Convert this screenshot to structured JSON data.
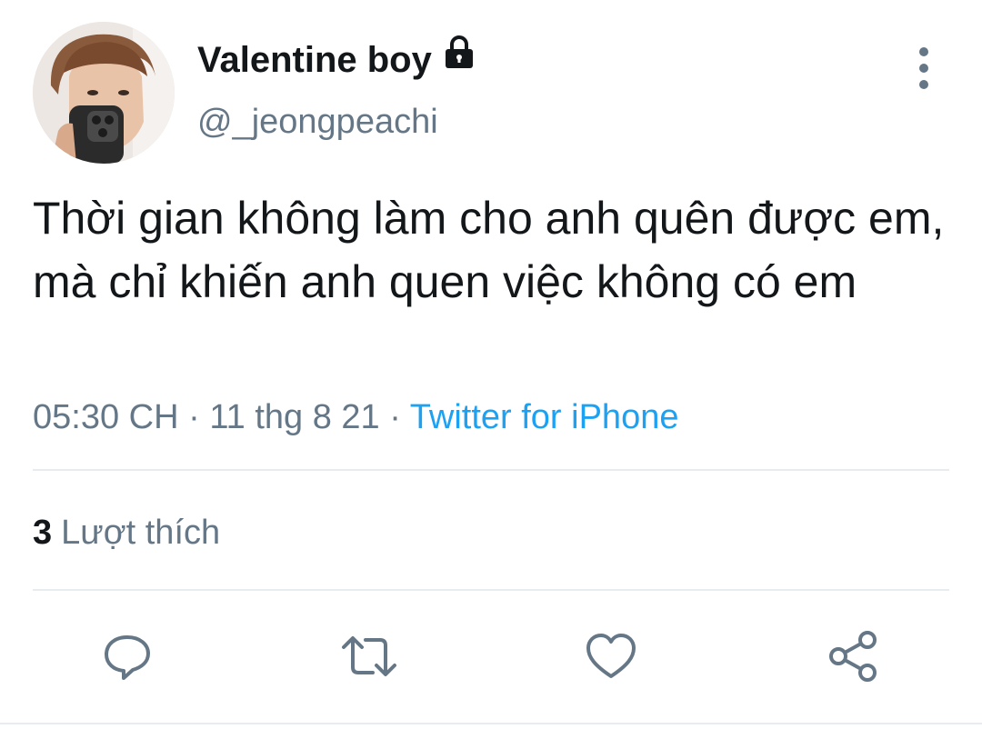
{
  "user": {
    "display_name": "Valentine boy",
    "handle": "@_jeongpeachi",
    "avatar_icon": "profile-photo",
    "protected_icon": "lock-icon"
  },
  "tweet": {
    "text": "Thời gian không làm cho anh quên được em, mà chỉ khiến anh quen việc không có em",
    "time": "05:30 CH",
    "separator1": " · ",
    "date": "11 thg 8 21",
    "separator2": " · ",
    "source": "Twitter for iPhone"
  },
  "stats": {
    "likes_count": "3",
    "likes_label": "Lượt thích"
  },
  "actions": {
    "reply_icon": "reply-icon",
    "retweet_icon": "retweet-icon",
    "like_icon": "heart-icon",
    "share_icon": "share-icon",
    "more_icon": "more-vertical-icon"
  },
  "colors": {
    "primary_text": "#14171a",
    "secondary_text": "#657786",
    "link": "#1da1f2",
    "divider": "#e6ecf0"
  }
}
